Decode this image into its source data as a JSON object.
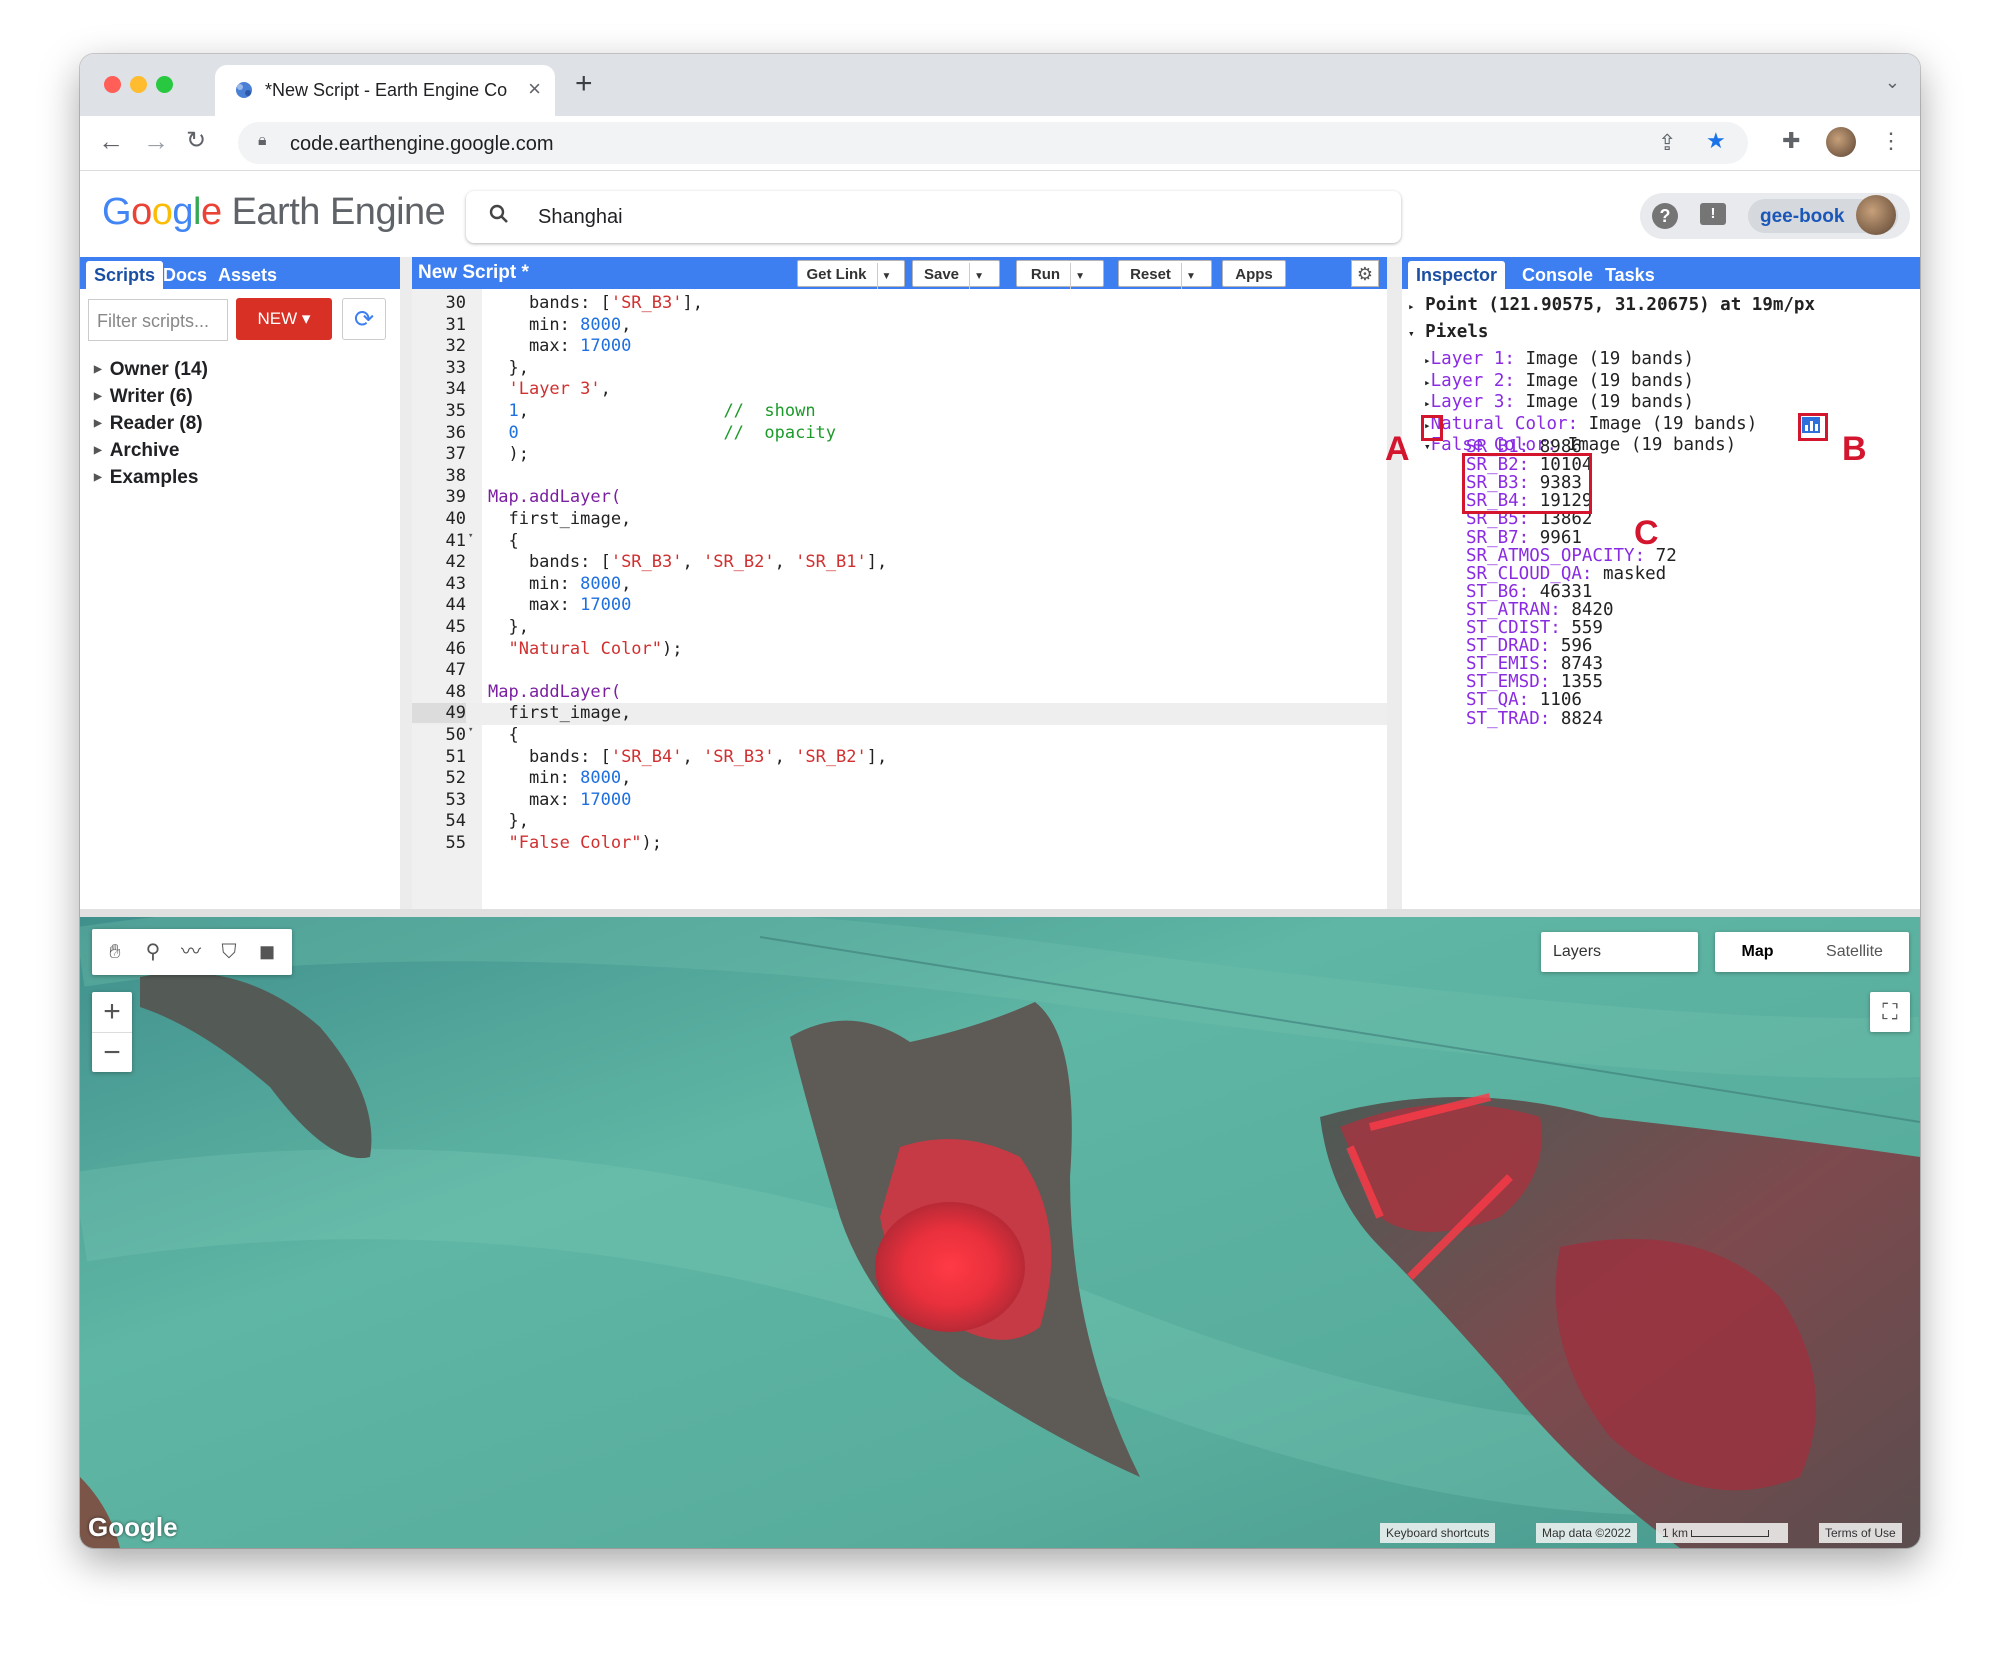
{
  "browser": {
    "tab_title": "*New Script - Earth Engine Co",
    "url": "code.earthengine.google.com"
  },
  "header": {
    "logo_google": "Google",
    "logo_product": "Earth Engine",
    "search_value": "Shanghai",
    "user": "gee-book"
  },
  "left_panel": {
    "tabs": [
      "Scripts",
      "Docs",
      "Assets"
    ],
    "filter_placeholder": "Filter scripts...",
    "new_button": "NEW",
    "tree": [
      "Owner (14)",
      "Writer (6)",
      "Reader (8)",
      "Archive",
      "Examples"
    ]
  },
  "editor": {
    "title": "New Script *",
    "buttons": [
      "Get Link",
      "Save",
      "Run",
      "Reset",
      "Apps"
    ],
    "first_line_number": 30,
    "highlighted_line": 49,
    "fold_lines": [
      41,
      50
    ],
    "lines": [
      [
        [
          "    bands: [",
          ""
        ],
        [
          "'SR_B3'",
          "s"
        ],
        [
          "],",
          ""
        ]
      ],
      [
        [
          "    min: ",
          ""
        ],
        [
          "8000",
          "n"
        ],
        [
          ",",
          ""
        ]
      ],
      [
        [
          "    max: ",
          ""
        ],
        [
          "17000",
          "n"
        ]
      ],
      [
        [
          "  },",
          ""
        ]
      ],
      [
        [
          "  ",
          ""
        ],
        [
          "'Layer 3'",
          "s"
        ],
        [
          ",",
          ""
        ]
      ],
      [
        [
          "  ",
          ""
        ],
        [
          "1",
          "n"
        ],
        [
          ",                   ",
          ""
        ],
        [
          "//  shown",
          "c"
        ]
      ],
      [
        [
          "  ",
          ""
        ],
        [
          "0",
          "n"
        ],
        [
          "                    ",
          ""
        ],
        [
          "//  opacity",
          "c"
        ]
      ],
      [
        [
          "  );",
          ""
        ]
      ],
      [
        [
          "",
          ""
        ]
      ],
      [
        [
          "Map.addLayer(",
          "f"
        ]
      ],
      [
        [
          "  first_image,",
          ""
        ]
      ],
      [
        [
          "  {",
          ""
        ]
      ],
      [
        [
          "    bands: [",
          ""
        ],
        [
          "'SR_B3'",
          "s"
        ],
        [
          ", ",
          ""
        ],
        [
          "'SR_B2'",
          "s"
        ],
        [
          ", ",
          ""
        ],
        [
          "'SR_B1'",
          "s"
        ],
        [
          "],",
          ""
        ]
      ],
      [
        [
          "    min: ",
          ""
        ],
        [
          "8000",
          "n"
        ],
        [
          ",",
          ""
        ]
      ],
      [
        [
          "    max: ",
          ""
        ],
        [
          "17000",
          "n"
        ]
      ],
      [
        [
          "  },",
          ""
        ]
      ],
      [
        [
          "  ",
          ""
        ],
        [
          "\"Natural Color\"",
          "s"
        ],
        [
          ");",
          ""
        ]
      ],
      [
        [
          "",
          ""
        ]
      ],
      [
        [
          "Map.addLayer(",
          "f"
        ]
      ],
      [
        [
          "  first_image,",
          ""
        ]
      ],
      [
        [
          "  {",
          ""
        ]
      ],
      [
        [
          "    bands: [",
          ""
        ],
        [
          "'SR_B4'",
          "s"
        ],
        [
          ", ",
          ""
        ],
        [
          "'SR_B3'",
          "s"
        ],
        [
          ", ",
          ""
        ],
        [
          "'SR_B2'",
          "s"
        ],
        [
          "],",
          ""
        ]
      ],
      [
        [
          "    min: ",
          ""
        ],
        [
          "8000",
          "n"
        ],
        [
          ",",
          ""
        ]
      ],
      [
        [
          "    max: ",
          ""
        ],
        [
          "17000",
          "n"
        ]
      ],
      [
        [
          "  },",
          ""
        ]
      ],
      [
        [
          "  ",
          ""
        ],
        [
          "\"False Color\"",
          "s"
        ],
        [
          ");",
          ""
        ]
      ]
    ]
  },
  "right_panel": {
    "tabs": [
      "Inspector",
      "Console",
      "Tasks"
    ],
    "point": "Point (121.90575, 31.20675) at 19m/px",
    "pixels_label": "Pixels",
    "layers": [
      {
        "name": "Layer 1:",
        "desc": "Image (19 bands)"
      },
      {
        "name": "Layer 2:",
        "desc": "Image (19 bands)"
      },
      {
        "name": "Layer 3:",
        "desc": "Image (19 bands)"
      },
      {
        "name": "Natural Color:",
        "desc": "Image (19 bands)"
      },
      {
        "name": "False Color:",
        "desc": "Image (19 bands)"
      }
    ],
    "bands": [
      {
        "k": "SR_B1:",
        "v": "8986"
      },
      {
        "k": "SR_B2:",
        "v": "10104"
      },
      {
        "k": "SR_B3:",
        "v": "9383"
      },
      {
        "k": "SR_B4:",
        "v": "19129"
      },
      {
        "k": "SR_B5:",
        "v": "13862"
      },
      {
        "k": "SR_B7:",
        "v": "9961"
      },
      {
        "k": "SR_ATMOS_OPACITY:",
        "v": "72"
      },
      {
        "k": "SR_CLOUD_QA:",
        "v": "masked"
      },
      {
        "k": "ST_B6:",
        "v": "46331"
      },
      {
        "k": "ST_ATRAN:",
        "v": "8420"
      },
      {
        "k": "ST_CDIST:",
        "v": "559"
      },
      {
        "k": "ST_DRAD:",
        "v": "596"
      },
      {
        "k": "ST_EMIS:",
        "v": "8743"
      },
      {
        "k": "ST_EMSD:",
        "v": "1355"
      },
      {
        "k": "ST_QA:",
        "v": "1106"
      },
      {
        "k": "ST_TRAD:",
        "v": "8824"
      }
    ],
    "annotations": {
      "a": "A",
      "b": "B",
      "c": "C"
    }
  },
  "map": {
    "layers_button": "Layers",
    "map_types": [
      "Map",
      "Satellite"
    ],
    "watermark": "Google",
    "footer": [
      "Keyboard shortcuts",
      "Map data ©2022",
      "1 km",
      "Terms of Use"
    ]
  },
  "colors": {
    "accent": "#3d7ff0",
    "annotation": "#d3152e",
    "water": "#4ea89a",
    "vegetation_false_color": "#e02a3a"
  }
}
